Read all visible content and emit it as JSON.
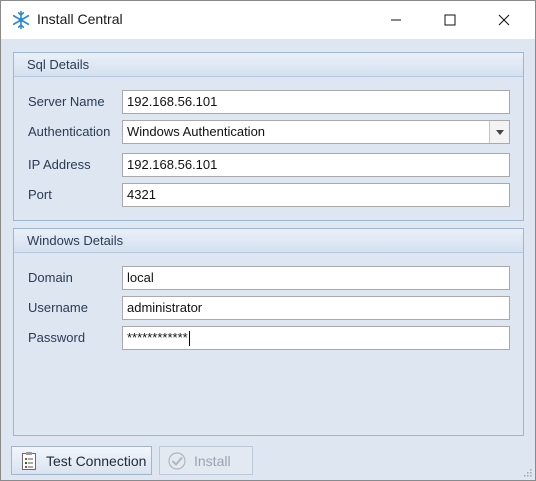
{
  "window": {
    "title": "Install Central",
    "icon": "snowflake-icon",
    "controls": [
      "minimize-icon",
      "maximize-icon",
      "close-icon"
    ]
  },
  "sql_details": {
    "header": "Sql Details",
    "server_name": {
      "label": "Server Name",
      "value": "192.168.56.101"
    },
    "authentication": {
      "label": "Authentication",
      "value": "Windows Authentication"
    },
    "ip_address": {
      "label": "IP Address",
      "value": "192.168.56.101"
    },
    "port": {
      "label": "Port",
      "value": "4321"
    }
  },
  "windows_details": {
    "header": "Windows Details",
    "domain": {
      "label": "Domain",
      "value": "local"
    },
    "username": {
      "label": "Username",
      "value": "administrator"
    },
    "password": {
      "label": "Password",
      "value": "************"
    }
  },
  "buttons": {
    "test_connection": "Test Connection",
    "install": "Install"
  },
  "colors": {
    "accent": "#2b88d8",
    "panel": "#dde6f1",
    "border": "#9fb6d0"
  }
}
